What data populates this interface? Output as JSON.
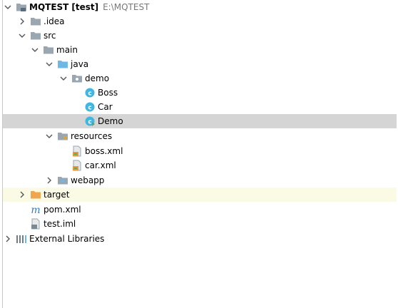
{
  "tree": {
    "project": {
      "name": "MQTEST",
      "module": "[test]",
      "path": "E:\\MQTEST"
    },
    "idea": {
      "label": ".idea"
    },
    "src": {
      "label": "src"
    },
    "main": {
      "label": "main"
    },
    "java": {
      "label": "java"
    },
    "demo_pkg": {
      "label": "demo"
    },
    "boss": {
      "label": "Boss"
    },
    "car": {
      "label": "Car"
    },
    "demo_class": {
      "label": "Demo"
    },
    "resources": {
      "label": "resources"
    },
    "boss_xml": {
      "label": "boss.xml"
    },
    "car_xml": {
      "label": "car.xml"
    },
    "webapp": {
      "label": "webapp"
    },
    "target": {
      "label": "target"
    },
    "pom": {
      "label": "pom.xml"
    },
    "iml": {
      "label": "test.iml"
    },
    "ext_libs": {
      "label": "External Libraries"
    }
  },
  "icons": {
    "folder": "folder-icon",
    "module-folder": "module-folder-icon",
    "source-folder": "source-folder-icon",
    "package": "package-icon",
    "class": "class-icon",
    "resources-folder": "resources-folder-icon",
    "xml": "xml-file-icon",
    "web-folder": "web-folder-icon",
    "excluded-folder": "excluded-folder-icon",
    "maven": "maven-icon",
    "iml": "iml-file-icon",
    "library": "library-icon"
  },
  "colors": {
    "selected_row": "#d5d5d5",
    "excluded_row": "#fbfae5",
    "folder": "#9aa7b0",
    "source_folder": "#6fb8e6",
    "class_icon": "#40b6e0",
    "excluded_folder": "#f0a64e",
    "maven": "#3d79b7"
  }
}
